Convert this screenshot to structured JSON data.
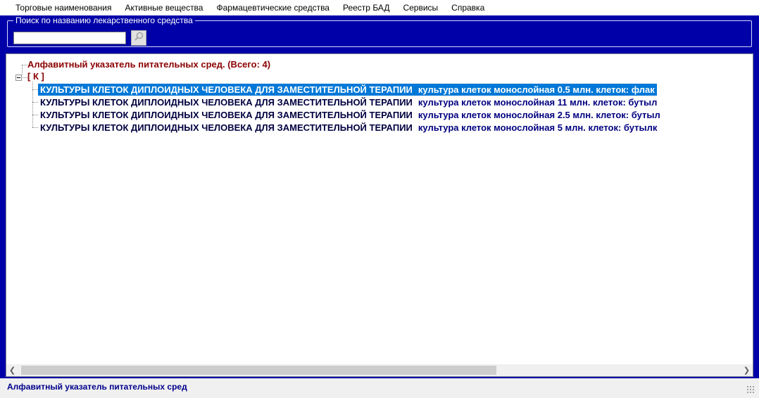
{
  "menu": [
    "Торговые наименования",
    "Активные вещества",
    "Фармацевтические средства",
    "Реестр БАД",
    "Сервисы",
    "Справка"
  ],
  "search": {
    "legend": "Поиск по названию лекарственного средства",
    "value": "",
    "button_icon": "search-icon"
  },
  "tree": {
    "root_label": "Алфавитный указатель питательных сред. (Всего: 4)",
    "group_label": "[ К ]",
    "items": [
      {
        "name": "КУЛЬТУРЫ КЛЕТОК ДИПЛОИДНЫХ ЧЕЛОВЕКА ДЛЯ ЗАМЕСТИТЕЛЬНОЙ ТЕРАПИИ",
        "desc": "культура клеток монослойная 0.5 млн. клеток: флак",
        "selected": true
      },
      {
        "name": "КУЛЬТУРЫ КЛЕТОК ДИПЛОИДНЫХ ЧЕЛОВЕКА ДЛЯ ЗАМЕСТИТЕЛЬНОЙ ТЕРАПИИ",
        "desc": "культура клеток монослойная 11 млн. клеток: бутыл",
        "selected": false
      },
      {
        "name": "КУЛЬТУРЫ КЛЕТОК ДИПЛОИДНЫХ ЧЕЛОВЕКА ДЛЯ ЗАМЕСТИТЕЛЬНОЙ ТЕРАПИИ",
        "desc": "культура клеток монослойная 2.5 млн. клеток: бутыл",
        "selected": false
      },
      {
        "name": "КУЛЬТУРЫ КЛЕТОК ДИПЛОИДНЫХ ЧЕЛОВЕКА ДЛЯ ЗАМЕСТИТЕЛЬНОЙ ТЕРАПИИ",
        "desc": "культура клеток монослойная 5 млн. клеток: бутылк",
        "selected": false
      }
    ]
  },
  "status": {
    "text": "Алфавитный указатель питательных сред"
  },
  "colors": {
    "band": "#0000a8",
    "selection": "#0078d7",
    "root_text": "#8b0000",
    "status_text": "#00008b"
  }
}
